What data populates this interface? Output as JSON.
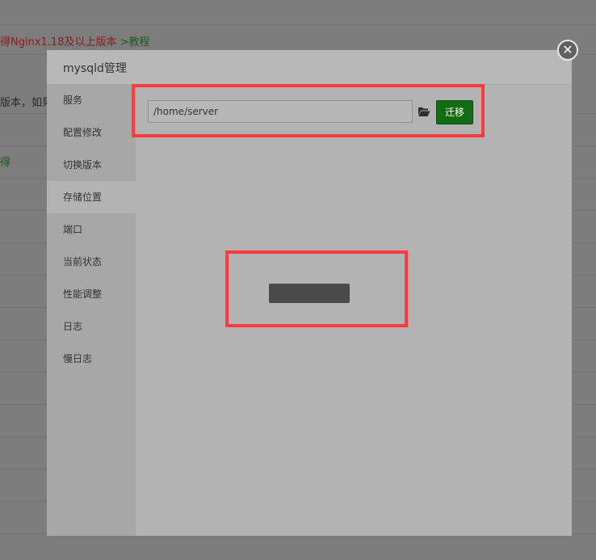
{
  "background": {
    "line1_prefix": "得Nginx1.18及以上版本",
    "line1_link": ">教程",
    "line2": "版本，如果要",
    "line3": "得"
  },
  "modal": {
    "title": "mysqld管理",
    "close_label": "✕"
  },
  "sidebar": {
    "items": [
      {
        "label": "服务"
      },
      {
        "label": "配置修改"
      },
      {
        "label": "切换版本"
      },
      {
        "label": "存储位置"
      },
      {
        "label": "端口"
      },
      {
        "label": "当前状态"
      },
      {
        "label": "性能调整"
      },
      {
        "label": "日志"
      },
      {
        "label": "慢日志"
      }
    ],
    "active": "存储位置"
  },
  "storage": {
    "path_value": "/home/server",
    "folder_icon": "folder-open-icon",
    "migrate_label": "迁移"
  },
  "colors": {
    "accent_green": "#136b13",
    "highlight_red": "#ff3b3b"
  }
}
